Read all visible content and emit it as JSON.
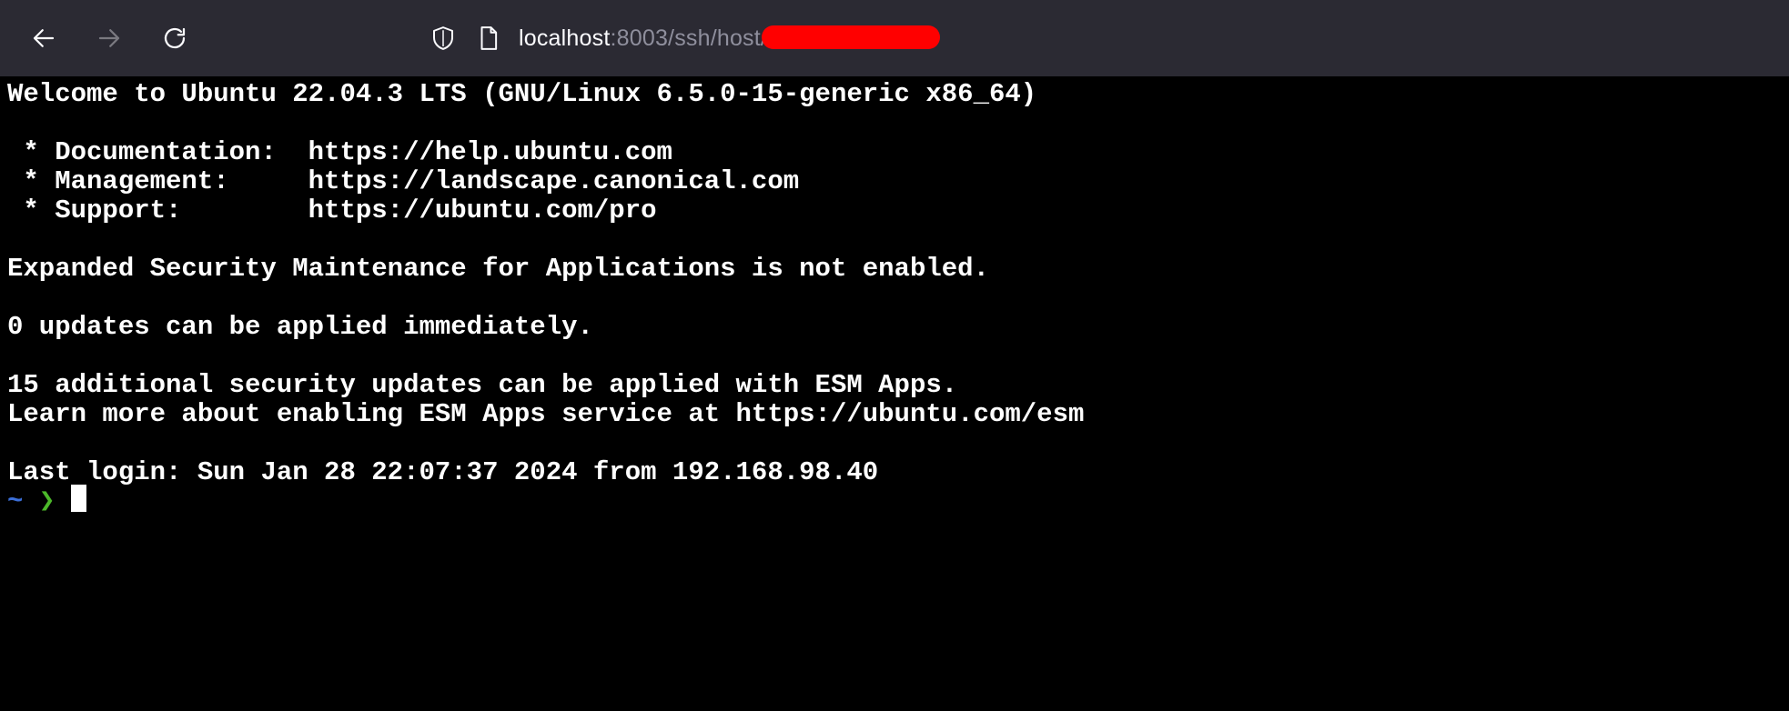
{
  "browser": {
    "url_host": "localhost",
    "url_path": ":8003/ssh/host/"
  },
  "icons": {
    "back": "arrow-left-icon",
    "forward": "arrow-right-icon",
    "reload": "reload-icon",
    "tracking": "shield-icon",
    "page": "page-icon"
  },
  "colors": {
    "toolbar_bg": "#2b2a33",
    "terminal_bg": "#000000",
    "terminal_fg": "#ffffff",
    "prompt_tilde": "#3b6ed8",
    "prompt_arrow": "#4cb82a",
    "redaction": "#ff0000"
  },
  "terminal": {
    "lines": [
      "Welcome to Ubuntu 22.04.3 LTS (GNU/Linux 6.5.0-15-generic x86_64)",
      "",
      " * Documentation:  https://help.ubuntu.com",
      " * Management:     https://landscape.canonical.com",
      " * Support:        https://ubuntu.com/pro",
      "",
      "Expanded Security Maintenance for Applications is not enabled.",
      "",
      "0 updates can be applied immediately.",
      "",
      "15 additional security updates can be applied with ESM Apps.",
      "Learn more about enabling ESM Apps service at https://ubuntu.com/esm",
      "",
      "Last login: Sun Jan 28 22:07:37 2024 from 192.168.98.40"
    ],
    "prompt_tilde": "~",
    "prompt_arrow": "❯"
  }
}
